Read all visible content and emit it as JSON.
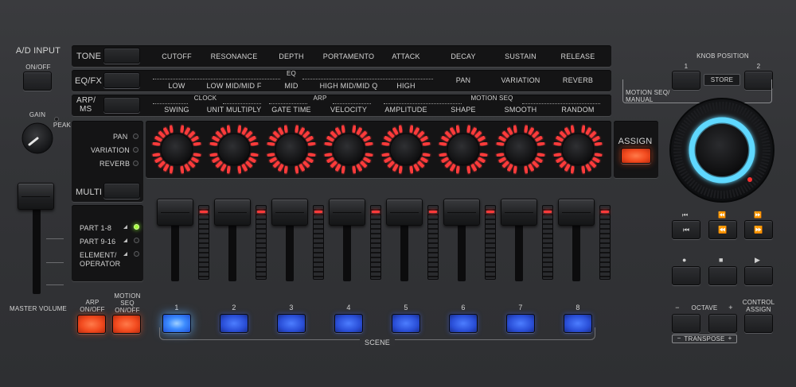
{
  "left": {
    "ad_input": "A/D INPUT",
    "on_off": "ON/OFF",
    "gain": "GAIN",
    "peak": "PEAK",
    "master_volume": "MASTER VOLUME"
  },
  "rows": {
    "tone": "TONE",
    "eqfx": "EQ/FX",
    "arp_ms_1": "ARP/",
    "arp_ms_2": "MS"
  },
  "tone_labels": [
    "CUTOFF",
    "RESONANCE",
    "DEPTH",
    "PORTAMENTO",
    "ATTACK",
    "DECAY",
    "SUSTAIN",
    "RELEASE"
  ],
  "eq_group": "EQ",
  "eq_labels": [
    "LOW",
    "LOW MID/MID F",
    "MID",
    "HIGH MID/MID Q",
    "HIGH",
    "PAN",
    "VARIATION",
    "REVERB"
  ],
  "clock_group": "CLOCK",
  "arp_group": "ARP",
  "motion_seq_group": "MOTION SEQ",
  "arp_labels": [
    "SWING",
    "UNIT MULTIPLY",
    "GATE TIME",
    "VELOCITY",
    "AMPLITUDE",
    "SHAPE",
    "SMOOTH",
    "RANDOM"
  ],
  "side_selectors": {
    "pan": "PAN",
    "variation": "VARIATION",
    "reverb": "REVERB",
    "multi": "MULTI"
  },
  "part_select": {
    "part_1_8": "PART  1-8",
    "part_9_16": "PART 9-16",
    "element_1": "ELEMENT/",
    "element_2": "OPERATOR",
    "active_led": "part_1_8"
  },
  "assign": "ASSIGN",
  "knob_position": {
    "title": "KNOB POSITION",
    "btn1": "1",
    "btn2": "2",
    "store": "STORE",
    "motion_1": "MOTION SEQ/",
    "motion_2": "MANUAL"
  },
  "transport": {
    "top": [
      "⏮",
      "⏪",
      "⏩"
    ],
    "bottom": [
      "●",
      "■",
      "▶"
    ]
  },
  "octave": {
    "minus": "−",
    "label": "OCTAVE",
    "plus": "+",
    "control_1": "CONTROL",
    "control_2": "ASSIGN",
    "transpose": "TRANSPOSE"
  },
  "arp_on_off_1": "ARP",
  "arp_on_off_2": "ON/OFF",
  "motion_on_off_1": "MOTION",
  "motion_on_off_2": "SEQ",
  "motion_on_off_3": "ON/OFF",
  "scene": {
    "label": "SCENE",
    "numbers": [
      "1",
      "2",
      "3",
      "4",
      "5",
      "6",
      "7",
      "8"
    ],
    "active": 1
  },
  "colors": {
    "knob_ring": "#ff3b3b",
    "led_green": "#a4ff3a",
    "orange_button": "#f24a1e",
    "blue_button": "#2a4fd8",
    "dial_ring": "#5fd8ff"
  }
}
